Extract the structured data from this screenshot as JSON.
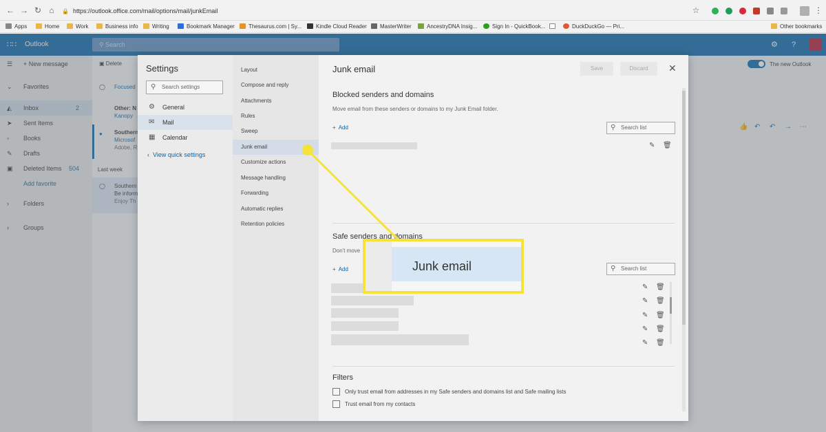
{
  "browser": {
    "url": "https://outlook.office.com/mail/options/mail/junkEmail",
    "bookmarks": [
      "Apps",
      "Home",
      "Work",
      "Business info",
      "Writing",
      "Bookmark Manager",
      "Thesaurus.com | Sy...",
      "Kindle Cloud Reader",
      "MasterWriter",
      "AncestryDNA Insig...",
      "Sign In - QuickBook...",
      "DuckDuckGo — Pri..."
    ],
    "other_bookmarks": "Other bookmarks"
  },
  "outlook": {
    "brand": "Outlook",
    "search_placeholder": "Search",
    "new_outlook_label": "The new Outlook"
  },
  "leftnav": {
    "new_message": "New message",
    "favorites": "Favorites",
    "inbox": "Inbox",
    "inbox_count": "2",
    "sent_items": "Sent Items",
    "books": "Books",
    "drafts": "Drafts",
    "deleted_items": "Deleted Items",
    "deleted_count": "504",
    "add_favorite": "Add favorite",
    "folders": "Folders",
    "groups": "Groups"
  },
  "msglist": {
    "delete": "Delete",
    "focused": "Focused",
    "other": "Other: N",
    "kanopy": "Kanopy",
    "southern1": "Southern",
    "microsoft": "Microsof",
    "adobe": "Adobe, R",
    "last_week": "Last week",
    "southern2": "Southern",
    "be_inform": "Be inform",
    "enjoy": "Enjoy Th"
  },
  "settings": {
    "title": "Settings",
    "search_placeholder": "Search settings",
    "categories": [
      "General",
      "Mail",
      "Calendar"
    ],
    "view_quick": "View quick settings",
    "subcategories": [
      "Layout",
      "Compose and reply",
      "Attachments",
      "Rules",
      "Sweep",
      "Junk email",
      "Customize actions",
      "Message handling",
      "Forwarding",
      "Automatic replies",
      "Retention policies"
    ]
  },
  "junk": {
    "title": "Junk email",
    "save": "Save",
    "discard": "Discard",
    "blocked_title": "Blocked senders and domains",
    "blocked_desc": "Move email from these senders or domains to my Junk Email folder.",
    "add": "Add",
    "search_list": "Search list",
    "safe_title": "Safe senders and domains",
    "safe_desc": "Don't move",
    "filters_title": "Filters",
    "filter_option_1": "Only trust email from addresses in my Safe senders and domains list and Safe mailing lists",
    "filter_option_2": "Trust email from my contacts"
  },
  "callout": {
    "label": "Junk email"
  },
  "colors": {
    "outlook_blue": "#0a66a9",
    "highlight_yellow": "#f5e33a"
  }
}
